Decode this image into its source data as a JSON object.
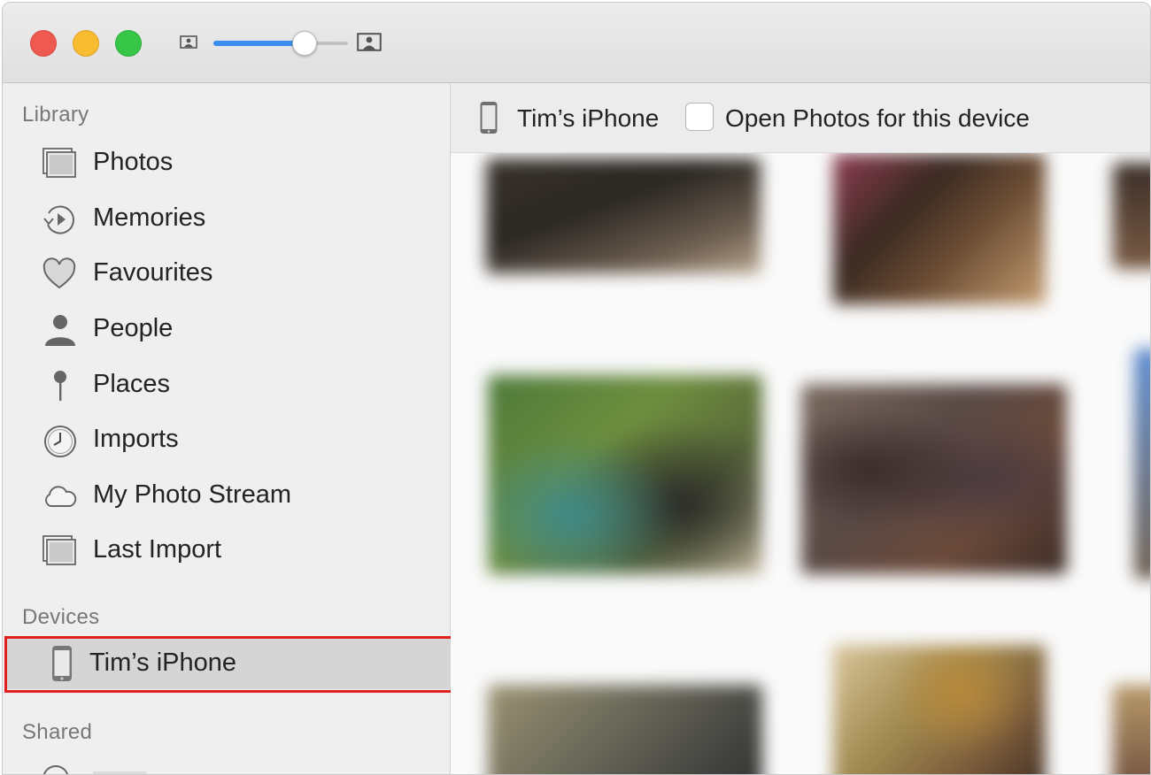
{
  "window": {
    "titlebar": {
      "zoom_slider_value": 0.67,
      "icons": [
        "zoom-out-photo-icon",
        "zoom-in-photo-icon"
      ]
    }
  },
  "sidebar": {
    "library_header": "Library",
    "library_items": [
      {
        "label": "Photos",
        "icon": "photos-stack-icon"
      },
      {
        "label": "Memories",
        "icon": "memories-icon"
      },
      {
        "label": "Favourites",
        "icon": "heart-icon"
      },
      {
        "label": "People",
        "icon": "person-icon"
      },
      {
        "label": "Places",
        "icon": "pin-icon"
      },
      {
        "label": "Imports",
        "icon": "clock-icon"
      },
      {
        "label": "My Photo Stream",
        "icon": "cloud-icon"
      },
      {
        "label": "Last Import",
        "icon": "photos-stack-icon"
      }
    ],
    "devices_header": "Devices",
    "device_item": {
      "label": "Tim’s iPhone",
      "icon": "iphone-icon",
      "selected": true
    },
    "shared_header": "Shared"
  },
  "content": {
    "device_bar": {
      "device_name": "Tim’s iPhone",
      "open_photos_label": "Open Photos for this device",
      "open_photos_checked": false
    }
  },
  "colors": {
    "highlight_border": "#e0201f",
    "slider_accent": "#3b8ef0",
    "selection_bg": "#d5d5d5"
  }
}
